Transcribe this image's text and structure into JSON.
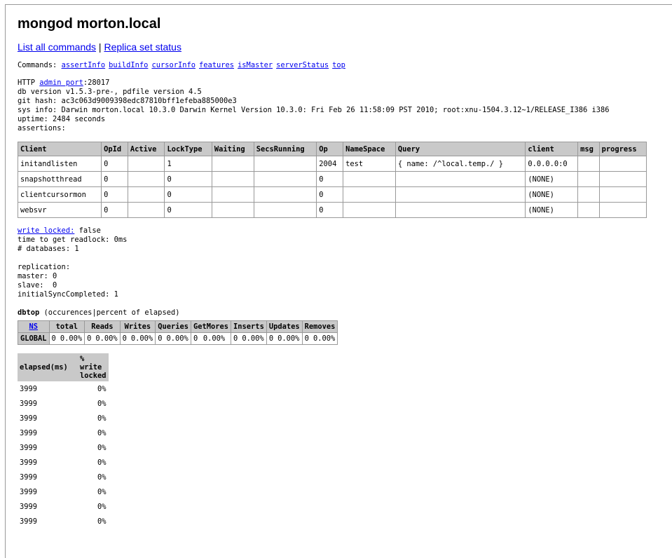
{
  "title": "mongod morton.local",
  "top_links": {
    "list_commands": "List all commands",
    "separator": " | ",
    "replica_status": "Replica set status"
  },
  "commands": {
    "label": "Commands: ",
    "items": [
      "assertInfo",
      "buildInfo",
      "cursorInfo",
      "features",
      "isMaster",
      "serverStatus",
      "top"
    ]
  },
  "server_info": {
    "http_prefix": "HTTP ",
    "admin_port_link": "admin port",
    "admin_port_value": ":28017",
    "db_version": "db version v1.5.3-pre-, pdfile version 4.5",
    "git_hash": "git hash: ac3c063d9009398edc87810bff1efeba885000e3",
    "sys_info": "sys info: Darwin morton.local 10.3.0 Darwin Kernel Version 10.3.0: Fri Feb 26 11:58:09 PST 2010; root:xnu-1504.3.12~1/RELEASE_I386 i386",
    "uptime": "uptime: 2484 seconds",
    "assertions": "assertions:"
  },
  "clients_table": {
    "headers": [
      "Client",
      "OpId",
      "Active",
      "LockType",
      "Waiting",
      "SecsRunning",
      "Op",
      "NameSpace",
      "Query",
      "client",
      "msg",
      "progress"
    ],
    "rows": [
      [
        "initandlisten",
        "0",
        "",
        "1",
        "",
        "",
        "2004",
        "test",
        "{ name: /^local.temp./ }",
        "0.0.0.0:0",
        "",
        ""
      ],
      [
        "snapshotthread",
        "0",
        "",
        "0",
        "",
        "",
        "0",
        "",
        "",
        "(NONE)",
        "",
        ""
      ],
      [
        "clientcursormon",
        "0",
        "",
        "0",
        "",
        "",
        "0",
        "",
        "",
        "(NONE)",
        "",
        ""
      ],
      [
        "websvr",
        "0",
        "",
        "0",
        "",
        "",
        "0",
        "",
        "",
        "(NONE)",
        "",
        ""
      ]
    ]
  },
  "lock_info": {
    "write_locked_link": "write locked:",
    "write_locked_value": " false",
    "readlock_time": "time to get readlock: 0ms",
    "databases": "# databases: 1"
  },
  "replication": {
    "heading": "replication:",
    "master": "master: 0",
    "slave": "slave:  0",
    "initial_sync": "initialSyncCompleted: 1"
  },
  "dbtop": {
    "label": "dbtop",
    "caption": " (occurences|percent of elapsed)",
    "ns_link": "NS",
    "headers": [
      "total",
      "Reads",
      "Writes",
      "Queries",
      "GetMores",
      "Inserts",
      "Updates",
      "Removes"
    ],
    "row_label": "GLOBAL",
    "cells": [
      [
        "0",
        "0.00%"
      ],
      [
        "0",
        "0.00%"
      ],
      [
        "0",
        "0.00%"
      ],
      [
        "0",
        "0.00%"
      ],
      [
        "0",
        "0.00%"
      ],
      [
        "0",
        "0.00%"
      ],
      [
        "0",
        "0.00%"
      ],
      [
        "0",
        "0.00%"
      ]
    ]
  },
  "elapsed": {
    "header_ms": "elapsed(ms)",
    "header_pct": "% write locked",
    "rows": [
      [
        "3999",
        "0%"
      ],
      [
        "3999",
        "0%"
      ],
      [
        "3999",
        "0%"
      ],
      [
        "3999",
        "0%"
      ],
      [
        "3999",
        "0%"
      ],
      [
        "3999",
        "0%"
      ],
      [
        "3999",
        "0%"
      ],
      [
        "3999",
        "0%"
      ],
      [
        "3999",
        "0%"
      ],
      [
        "3999",
        "0%"
      ]
    ]
  }
}
